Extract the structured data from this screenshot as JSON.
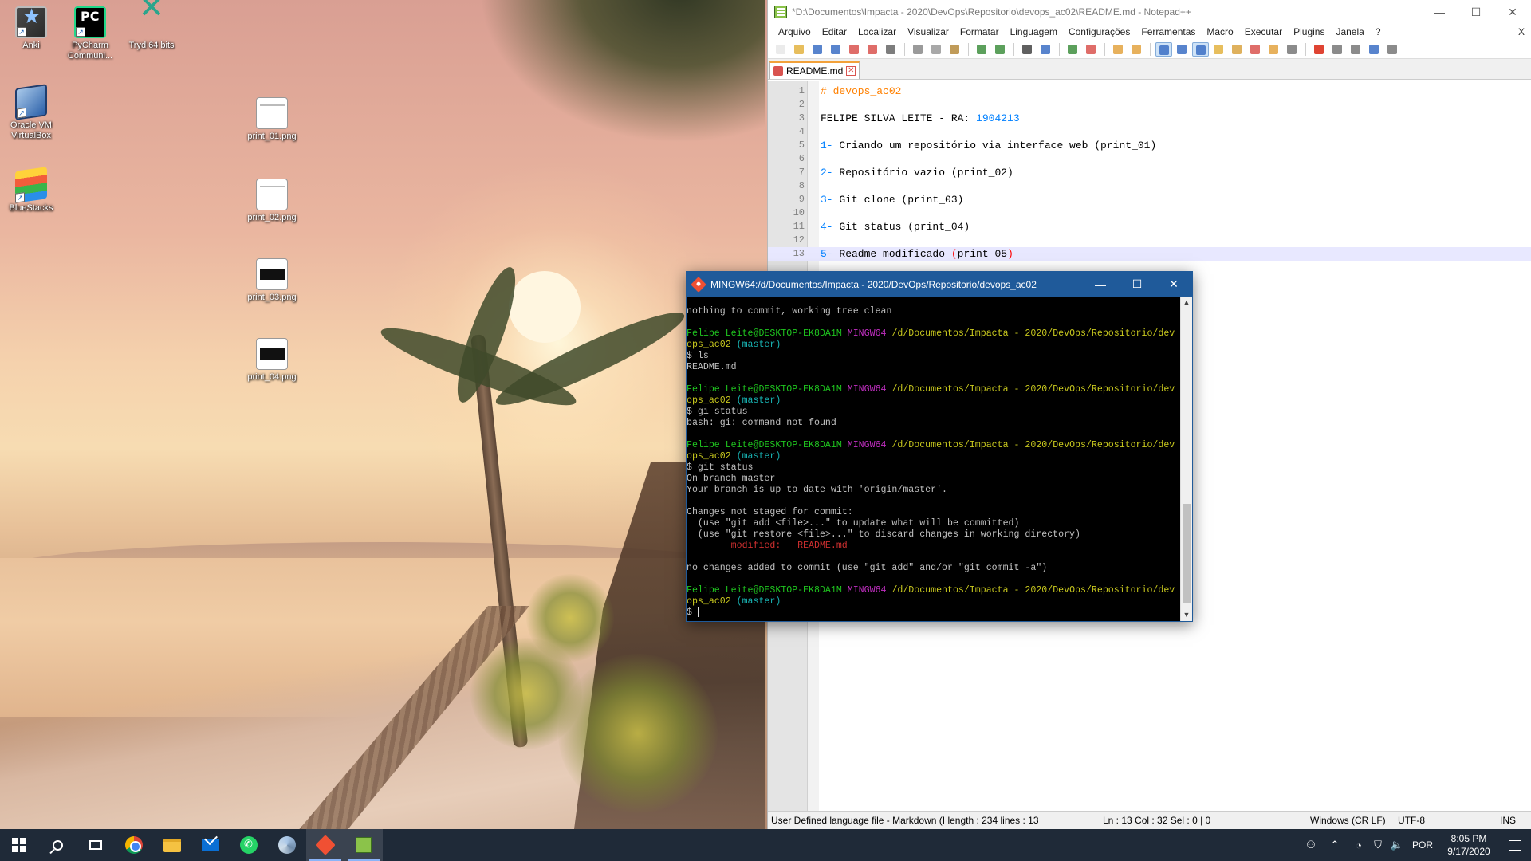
{
  "desktop": {
    "icons": [
      {
        "label": "Anki",
        "icon": "anki-icon"
      },
      {
        "label": "PyCharm Communi...",
        "icon": "pycharm-icon"
      },
      {
        "label": "Tryd 64 bits",
        "icon": "tryd-icon"
      },
      {
        "label": "Oracle VM VirtualBox",
        "icon": "virtualbox-icon"
      },
      {
        "label": "BlueStacks",
        "icon": "bluestacks-icon"
      },
      {
        "label": "print_01.png",
        "icon": "png-file-icon"
      },
      {
        "label": "print_02.png",
        "icon": "png-file-icon"
      },
      {
        "label": "print_03.png",
        "icon": "png-file-icon"
      },
      {
        "label": "print_04.png",
        "icon": "png-file-icon"
      }
    ]
  },
  "notepad": {
    "title": "*D:\\Documentos\\Impacta - 2020\\DevOps\\Repositorio\\devops_ac02\\README.md - Notepad++",
    "window_controls": {
      "minimize": "—",
      "maximize": "☐",
      "close": "✕"
    },
    "menu": [
      "Arquivo",
      "Editar",
      "Localizar",
      "Visualizar",
      "Formatar",
      "Linguagem",
      "Configurações",
      "Ferramentas",
      "Macro",
      "Executar",
      "Plugins",
      "Janela",
      "?"
    ],
    "menu_close": "X",
    "tab": {
      "label": "README.md",
      "close": "✕"
    },
    "lines": [
      {
        "n": "1",
        "parts": [
          {
            "t": "# devops_ac02",
            "c": "md-head"
          }
        ]
      },
      {
        "n": "2",
        "parts": [
          {
            "t": "",
            "c": ""
          }
        ]
      },
      {
        "n": "3",
        "parts": [
          {
            "t": "FELIPE SILVA LEITE - RA: ",
            "c": ""
          },
          {
            "t": "1904213",
            "c": "md-num"
          }
        ]
      },
      {
        "n": "4",
        "parts": [
          {
            "t": "",
            "c": ""
          }
        ]
      },
      {
        "n": "5",
        "parts": [
          {
            "t": "1- ",
            "c": "md-num"
          },
          {
            "t": "Criando um repositório via interface web (print_01)",
            "c": ""
          }
        ]
      },
      {
        "n": "6",
        "parts": [
          {
            "t": "",
            "c": ""
          }
        ]
      },
      {
        "n": "7",
        "parts": [
          {
            "t": "2- ",
            "c": "md-num"
          },
          {
            "t": "Repositório vazio (print_02)",
            "c": ""
          }
        ]
      },
      {
        "n": "8",
        "parts": [
          {
            "t": "",
            "c": ""
          }
        ]
      },
      {
        "n": "9",
        "parts": [
          {
            "t": "3- ",
            "c": "md-num"
          },
          {
            "t": "Git clone (print_03)",
            "c": ""
          }
        ]
      },
      {
        "n": "10",
        "parts": [
          {
            "t": "",
            "c": ""
          }
        ]
      },
      {
        "n": "11",
        "parts": [
          {
            "t": "4- ",
            "c": "md-num"
          },
          {
            "t": "Git status (print_04)",
            "c": ""
          }
        ]
      },
      {
        "n": "12",
        "parts": [
          {
            "t": "",
            "c": ""
          }
        ]
      },
      {
        "n": "13",
        "parts": [
          {
            "t": "5- ",
            "c": "md-num"
          },
          {
            "t": "Readme modificado ",
            "c": ""
          },
          {
            "t": "(",
            "c": "md-paren"
          },
          {
            "t": "print_05",
            "c": ""
          },
          {
            "t": ")",
            "c": "md-paren"
          }
        ],
        "current": true
      }
    ],
    "status": {
      "lang": "User Defined language file - Markdown (I length : 234   lines : 13",
      "pos": "Ln : 13    Col : 32    Sel : 0 | 0",
      "eol": "Windows (CR LF)",
      "enc": "UTF-8",
      "mode": "INS"
    }
  },
  "terminal": {
    "title": "MINGW64:/d/Documentos/Impacta - 2020/DevOps/Repositorio/devops_ac02",
    "window_controls": {
      "minimize": "—",
      "maximize": "☐",
      "close": "✕"
    },
    "lines": [
      [
        {
          "t": "nothing to commit, working tree clean",
          "c": ""
        }
      ],
      [
        {
          "t": "",
          "c": ""
        }
      ],
      [
        {
          "t": "Felipe Leite@DESKTOP-EK8DA1M ",
          "c": "t-green"
        },
        {
          "t": "MINGW64 ",
          "c": "t-mag"
        },
        {
          "t": "/d/Documentos/Impacta - 2020/DevOps/Repositorio/dev",
          "c": "t-yel"
        }
      ],
      [
        {
          "t": "ops_ac02 ",
          "c": "t-yel"
        },
        {
          "t": "(master)",
          "c": "t-cyan"
        }
      ],
      [
        {
          "t": "$ ls",
          "c": ""
        }
      ],
      [
        {
          "t": "README.md",
          "c": ""
        }
      ],
      [
        {
          "t": "",
          "c": ""
        }
      ],
      [
        {
          "t": "Felipe Leite@DESKTOP-EK8DA1M ",
          "c": "t-green"
        },
        {
          "t": "MINGW64 ",
          "c": "t-mag"
        },
        {
          "t": "/d/Documentos/Impacta - 2020/DevOps/Repositorio/dev",
          "c": "t-yel"
        }
      ],
      [
        {
          "t": "ops_ac02 ",
          "c": "t-yel"
        },
        {
          "t": "(master)",
          "c": "t-cyan"
        }
      ],
      [
        {
          "t": "$ gi status",
          "c": ""
        }
      ],
      [
        {
          "t": "bash: gi: command not found",
          "c": ""
        }
      ],
      [
        {
          "t": "",
          "c": ""
        }
      ],
      [
        {
          "t": "Felipe Leite@DESKTOP-EK8DA1M ",
          "c": "t-green"
        },
        {
          "t": "MINGW64 ",
          "c": "t-mag"
        },
        {
          "t": "/d/Documentos/Impacta - 2020/DevOps/Repositorio/dev",
          "c": "t-yel"
        }
      ],
      [
        {
          "t": "ops_ac02 ",
          "c": "t-yel"
        },
        {
          "t": "(master)",
          "c": "t-cyan"
        }
      ],
      [
        {
          "t": "$ git status",
          "c": ""
        }
      ],
      [
        {
          "t": "On branch master",
          "c": ""
        }
      ],
      [
        {
          "t": "Your branch is up to date with 'origin/master'.",
          "c": ""
        }
      ],
      [
        {
          "t": "",
          "c": ""
        }
      ],
      [
        {
          "t": "Changes not staged for commit:",
          "c": ""
        }
      ],
      [
        {
          "t": "  (use \"git add <file>...\" to update what will be committed)",
          "c": ""
        }
      ],
      [
        {
          "t": "  (use \"git restore <file>...\" to discard changes in working directory)",
          "c": ""
        }
      ],
      [
        {
          "t": "        modified:   README.md",
          "c": "t-red"
        }
      ],
      [
        {
          "t": "",
          "c": ""
        }
      ],
      [
        {
          "t": "no changes added to commit (use \"git add\" and/or \"git commit -a\")",
          "c": ""
        }
      ],
      [
        {
          "t": "",
          "c": ""
        }
      ],
      [
        {
          "t": "Felipe Leite@DESKTOP-EK8DA1M ",
          "c": "t-green"
        },
        {
          "t": "MINGW64 ",
          "c": "t-mag"
        },
        {
          "t": "/d/Documentos/Impacta - 2020/DevOps/Repositorio/dev",
          "c": "t-yel"
        }
      ],
      [
        {
          "t": "ops_ac02 ",
          "c": "t-yel"
        },
        {
          "t": "(master)",
          "c": "t-cyan"
        }
      ],
      [
        {
          "t": "$ ",
          "c": ""
        }
      ]
    ],
    "scroll_up": "▲",
    "scroll_down": "▼"
  },
  "taskbar": {
    "apps": [
      "start-icon",
      "search-icon",
      "task-view-icon",
      "chrome-icon",
      "file-explorer-icon",
      "mail-icon",
      "whatsapp-icon",
      "bird-app-icon",
      "git-bash-icon",
      "notepadpp-icon"
    ],
    "tray": {
      "people": "⚇",
      "chevron": "⌃",
      "network": "◔",
      "security": "⛉",
      "volume": "🔈",
      "language": "POR",
      "time": "8:05 PM",
      "date": "9/17/2020"
    }
  }
}
